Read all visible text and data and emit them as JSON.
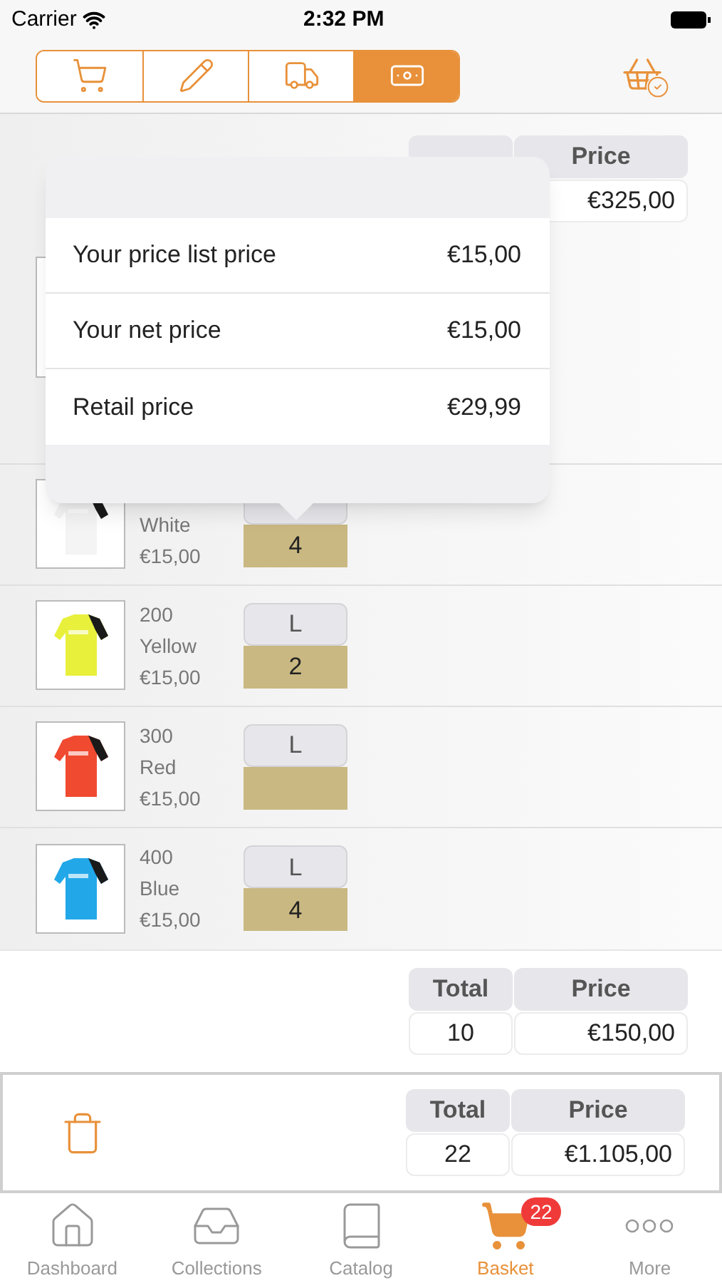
{
  "status_bar": {
    "carrier": "Carrier",
    "time": "2:32 PM"
  },
  "segments": [
    {
      "kind": "cart",
      "selected": false
    },
    {
      "kind": "edit",
      "selected": false
    },
    {
      "kind": "delivery",
      "selected": false
    },
    {
      "kind": "money",
      "selected": true
    }
  ],
  "order_totals": {
    "price_header": "Price",
    "price": "€325,00"
  },
  "popover": {
    "rows": [
      {
        "label": "Your price list price",
        "value": "€15,00"
      },
      {
        "label": "Your net price",
        "value": "€15,00"
      },
      {
        "label": "Retail price",
        "value": "€29,99"
      }
    ]
  },
  "variants": [
    {
      "color_name": "White",
      "price": "€15,00",
      "quantity": "4",
      "color": "#f4f4f4"
    },
    {
      "number": "200",
      "color_name": "Yellow",
      "price": "€15,00",
      "size": "L",
      "quantity": "2",
      "color": "#e8f03c"
    },
    {
      "number": "300",
      "color_name": "Red",
      "price": "€15,00",
      "size": "L",
      "color": "#f04a30"
    },
    {
      "number": "400",
      "color_name": "Blue",
      "price": "€15,00",
      "size": "L",
      "quantity": "4",
      "color": "#22a8e8"
    }
  ],
  "product_totals": {
    "total_header": "Total",
    "price_header": "Price",
    "total": "10",
    "price": "€150,00"
  },
  "basket_totals": {
    "total_header": "Total",
    "price_header": "Price",
    "total": "22",
    "price": "€1.105,00"
  },
  "tab_bar": [
    {
      "kind": "dashboard",
      "label": "Dashboard",
      "selected": false
    },
    {
      "kind": "collections",
      "label": "Collections",
      "selected": false
    },
    {
      "kind": "catalog",
      "label": "Catalog",
      "selected": false
    },
    {
      "kind": "basket",
      "label": "Basket",
      "selected": true,
      "badge": "22"
    },
    {
      "kind": "more",
      "label": "More",
      "selected": false
    }
  ]
}
